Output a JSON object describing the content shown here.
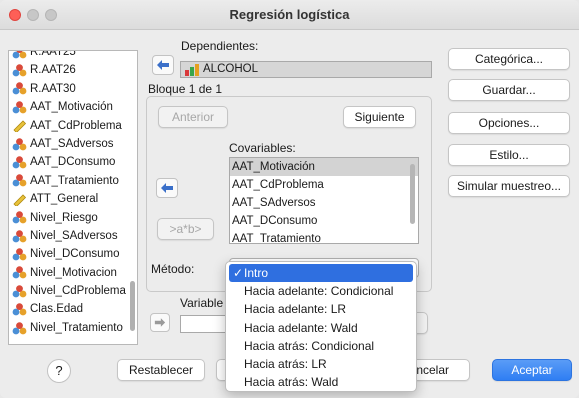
{
  "window": {
    "title": "Regresión logística"
  },
  "variables": [
    {
      "label": "R.AAT25",
      "icon": "scale-nominal-icon"
    },
    {
      "label": "R.AAT26",
      "icon": "scale-nominal-icon"
    },
    {
      "label": "R.AAT30",
      "icon": "scale-nominal-icon"
    },
    {
      "label": "AAT_Motivación",
      "icon": "scale-nominal-icon"
    },
    {
      "label": "AAT_CdProblema",
      "icon": "ruler-scale-icon"
    },
    {
      "label": "AAT_SAdversos",
      "icon": "scale-nominal-icon"
    },
    {
      "label": "AAT_DConsumo",
      "icon": "scale-nominal-icon"
    },
    {
      "label": "AAT_Tratamiento",
      "icon": "scale-nominal-icon"
    },
    {
      "label": "ATT_General",
      "icon": "ruler-scale-icon"
    },
    {
      "label": "Nivel_Riesgo",
      "icon": "scale-nominal-icon"
    },
    {
      "label": "Nivel_SAdversos",
      "icon": "scale-nominal-icon"
    },
    {
      "label": "Nivel_DConsumo",
      "icon": "scale-nominal-icon"
    },
    {
      "label": "Nivel_Motivacion",
      "icon": "scale-nominal-icon"
    },
    {
      "label": "Nivel_CdProblema",
      "icon": "scale-nominal-icon"
    },
    {
      "label": "Clas.Edad",
      "icon": "scale-nominal-icon"
    },
    {
      "label": "Nivel_Tratamiento",
      "icon": "scale-nominal-icon"
    }
  ],
  "dependent": {
    "label": "Dependientes:",
    "value": "ALCOHOL"
  },
  "block": {
    "label": "Bloque 1 de 1",
    "prev": "Anterior",
    "next": "Siguiente"
  },
  "covariates": {
    "label": "Covariables:",
    "items": [
      "AAT_Motivación",
      "AAT_CdProblema",
      "AAT_SAdversos",
      "AAT_DConsumo",
      "AAT_Tratamiento"
    ],
    "interaction_button": ">a*b>"
  },
  "method": {
    "label": "Método:",
    "selected": "Intro",
    "options": [
      "Intro",
      "Hacia adelante: Condicional",
      "Hacia adelante: LR",
      "Hacia adelante: Wald",
      "Hacia atrás: Condicional",
      "Hacia atrás: LR",
      "Hacia atrás: Wald"
    ]
  },
  "selection_variable": {
    "label": "Variable"
  },
  "side_buttons": [
    "Categórica...",
    "Guardar...",
    "Opciones...",
    "Estilo...",
    "Simular muestreo..."
  ],
  "footer": {
    "help": "?",
    "reset": "Restablecer",
    "cancel": "Cancelar",
    "ok": "Aceptar"
  },
  "colors": {
    "accent": "#2f7ef3",
    "close": "#fe5f57"
  }
}
